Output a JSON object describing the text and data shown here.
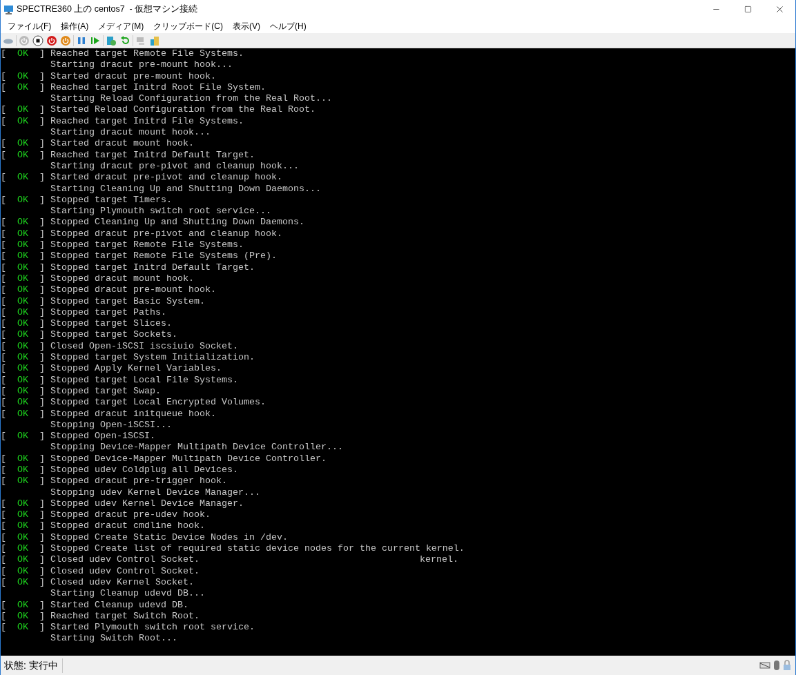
{
  "window": {
    "title": "SPECTRE360 上の centos7  - 仮想マシン接続"
  },
  "menu": [
    "ファイル(F)",
    "操作(A)",
    "メディア(M)",
    "クリップボード(C)",
    "表示(V)",
    "ヘルプ(H)"
  ],
  "console": [
    {
      "open": "[",
      "status": "OK",
      "close": "]",
      "text": "Reached target Remote File Systems."
    },
    {
      "text": "Starting dracut pre-mount hook..."
    },
    {
      "open": "[",
      "status": "OK",
      "close": "]",
      "text": "Started dracut pre-mount hook."
    },
    {
      "open": "[",
      "status": "OK",
      "close": "]",
      "text": "Reached target Initrd Root File System."
    },
    {
      "text": "Starting Reload Configuration from the Real Root..."
    },
    {
      "open": "[",
      "status": "OK",
      "close": "]",
      "text": "Started Reload Configuration from the Real Root."
    },
    {
      "open": "[",
      "status": "OK",
      "close": "]",
      "text": "Reached target Initrd File Systems."
    },
    {
      "text": "Starting dracut mount hook..."
    },
    {
      "open": "[",
      "status": "OK",
      "close": "]",
      "text": "Started dracut mount hook."
    },
    {
      "open": "[",
      "status": "OK",
      "close": "]",
      "text": "Reached target Initrd Default Target."
    },
    {
      "text": "Starting dracut pre-pivot and cleanup hook..."
    },
    {
      "open": "[",
      "status": "OK",
      "close": "]",
      "text": "Started dracut pre-pivot and cleanup hook."
    },
    {
      "text": "Starting Cleaning Up and Shutting Down Daemons..."
    },
    {
      "open": "[",
      "status": "OK",
      "close": "]",
      "text": "Stopped target Timers."
    },
    {
      "text": "Starting Plymouth switch root service..."
    },
    {
      "open": "[",
      "status": "OK",
      "close": "]",
      "text": "Stopped Cleaning Up and Shutting Down Daemons."
    },
    {
      "open": "[",
      "status": "OK",
      "close": "]",
      "text": "Stopped dracut pre-pivot and cleanup hook."
    },
    {
      "open": "[",
      "status": "OK",
      "close": "]",
      "text": "Stopped target Remote File Systems."
    },
    {
      "open": "[",
      "status": "OK",
      "close": "]",
      "text": "Stopped target Remote File Systems (Pre)."
    },
    {
      "open": "[",
      "status": "OK",
      "close": "]",
      "text": "Stopped target Initrd Default Target."
    },
    {
      "open": "[",
      "status": "OK",
      "close": "]",
      "text": "Stopped dracut mount hook."
    },
    {
      "open": "[",
      "status": "OK",
      "close": "]",
      "text": "Stopped dracut pre-mount hook."
    },
    {
      "open": "[",
      "status": "OK",
      "close": "]",
      "text": "Stopped target Basic System."
    },
    {
      "open": "[",
      "status": "OK",
      "close": "]",
      "text": "Stopped target Paths."
    },
    {
      "open": "[",
      "status": "OK",
      "close": "]",
      "text": "Stopped target Slices."
    },
    {
      "open": "[",
      "status": "OK",
      "close": "]",
      "text": "Stopped target Sockets."
    },
    {
      "open": "[",
      "status": "OK",
      "close": "]",
      "text": "Closed Open-iSCSI iscsiuio Socket."
    },
    {
      "open": "[",
      "status": "OK",
      "close": "]",
      "text": "Stopped target System Initialization."
    },
    {
      "open": "[",
      "status": "OK",
      "close": "]",
      "text": "Stopped Apply Kernel Variables."
    },
    {
      "open": "[",
      "status": "OK",
      "close": "]",
      "text": "Stopped target Local File Systems."
    },
    {
      "open": "[",
      "status": "OK",
      "close": "]",
      "text": "Stopped target Swap."
    },
    {
      "open": "[",
      "status": "OK",
      "close": "]",
      "text": "Stopped target Local Encrypted Volumes."
    },
    {
      "open": "[",
      "status": "OK",
      "close": "]",
      "text": "Stopped dracut initqueue hook."
    },
    {
      "text": "Stopping Open-iSCSI..."
    },
    {
      "open": "[",
      "status": "OK",
      "close": "]",
      "text": "Stopped Open-iSCSI."
    },
    {
      "text": "Stopping Device-Mapper Multipath Device Controller..."
    },
    {
      "open": "[",
      "status": "OK",
      "close": "]",
      "text": "Stopped Device-Mapper Multipath Device Controller."
    },
    {
      "open": "[",
      "status": "OK",
      "close": "]",
      "text": "Stopped udev Coldplug all Devices."
    },
    {
      "open": "[",
      "status": "OK",
      "close": "]",
      "text": "Stopped dracut pre-trigger hook."
    },
    {
      "text": "Stopping udev Kernel Device Manager..."
    },
    {
      "open": "[",
      "status": "OK",
      "close": "]",
      "text": "Stopped udev Kernel Device Manager."
    },
    {
      "open": "[",
      "status": "OK",
      "close": "]",
      "text": "Stopped dracut pre-udev hook."
    },
    {
      "open": "[",
      "status": "OK",
      "close": "]",
      "text": "Stopped dracut cmdline hook."
    },
    {
      "open": "[",
      "status": "OK",
      "close": "]",
      "text": "Stopped Create Static Device Nodes in /dev."
    },
    {
      "open": "[",
      "status": "OK",
      "close": "]",
      "text": "Stopped Create list of required static device nodes for the current kernel."
    },
    {
      "open": "[",
      "status": "OK",
      "close": "]",
      "text": "Closed udev Control Socket.",
      "tail": "kernel."
    },
    {
      "open": "[",
      "status": "OK",
      "close": "]",
      "text": "Closed udev Control Socket."
    },
    {
      "open": "[",
      "status": "OK",
      "close": "]",
      "text": "Closed udev Kernel Socket."
    },
    {
      "text": "Starting Cleanup udevd DB..."
    },
    {
      "open": "[",
      "status": "OK",
      "close": "]",
      "text": "Started Cleanup udevd DB."
    },
    {
      "open": "[",
      "status": "OK",
      "close": "]",
      "text": "Reached target Switch Root."
    },
    {
      "open": "[",
      "status": "OK",
      "close": "]",
      "text": "Started Plymouth switch root service."
    },
    {
      "text": "Starting Switch Root..."
    }
  ],
  "status_bar": {
    "text": "状態: 実行中"
  }
}
